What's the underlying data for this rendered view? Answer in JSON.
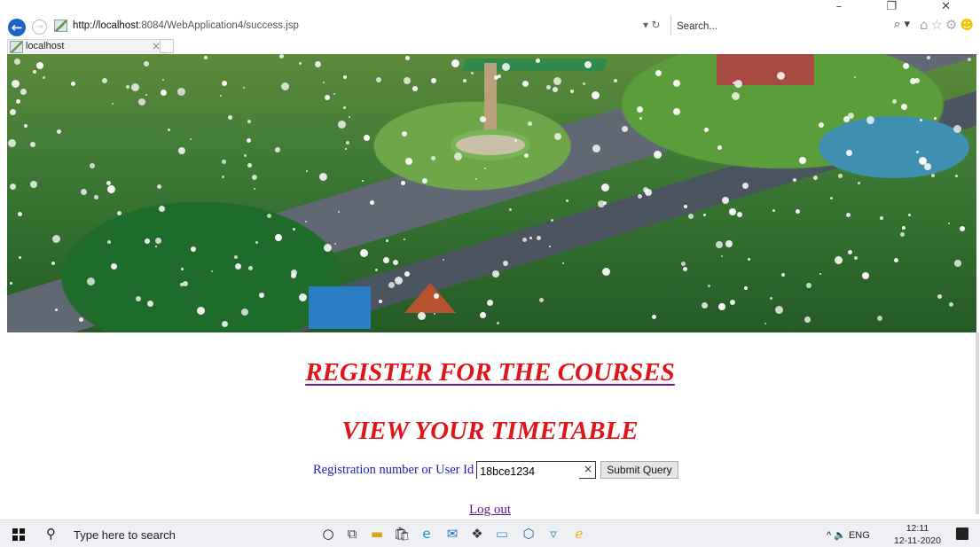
{
  "browser": {
    "url_host": "http://localhost",
    "url_rest": ":8084/WebApplication4/success.jsp",
    "refresh_controls": "▾ ↻",
    "search_placeholder": "Search...",
    "search_icon": "⌕ ▾",
    "window_controls": "– ❐ ✕",
    "toolbar_icons": "⌂☆⚙",
    "tab_title": "localhost",
    "tab_close": "×"
  },
  "page": {
    "heading_register": "REGISTER FOR THE COURSES",
    "heading_timetable": "VIEW YOUR TIMETABLE",
    "form_label": "Registration number or User Id",
    "form_value": "18bce1234",
    "clear_glyph": "×",
    "submit_label": "Submit Query",
    "logout_label": "Log out"
  },
  "taskbar": {
    "search_text": "Type here to search",
    "tray_text": "^ 🔈 ENG",
    "time": "12:11",
    "date": "12-11-2020",
    "icons": [
      {
        "name": "cortana-icon",
        "glyph": "○"
      },
      {
        "name": "task-view-icon",
        "glyph": "⧉"
      },
      {
        "name": "file-explorer-icon",
        "glyph": "▬"
      },
      {
        "name": "store-icon",
        "glyph": "🛍"
      },
      {
        "name": "edge-icon",
        "glyph": "e"
      },
      {
        "name": "mail-icon",
        "glyph": "✉"
      },
      {
        "name": "dropbox-icon",
        "glyph": "❖"
      },
      {
        "name": "amazon-icon",
        "glyph": "▭"
      },
      {
        "name": "security-icon",
        "glyph": "⬡"
      },
      {
        "name": "app-icon",
        "glyph": "▿"
      },
      {
        "name": "internet-explorer-icon",
        "glyph": "ℯ"
      }
    ],
    "colors": {
      "accent": "#1d63c7",
      "heading_red": "#e0151b",
      "label_blue": "#1a1ab4",
      "link_purple": "#551a8b"
    }
  }
}
